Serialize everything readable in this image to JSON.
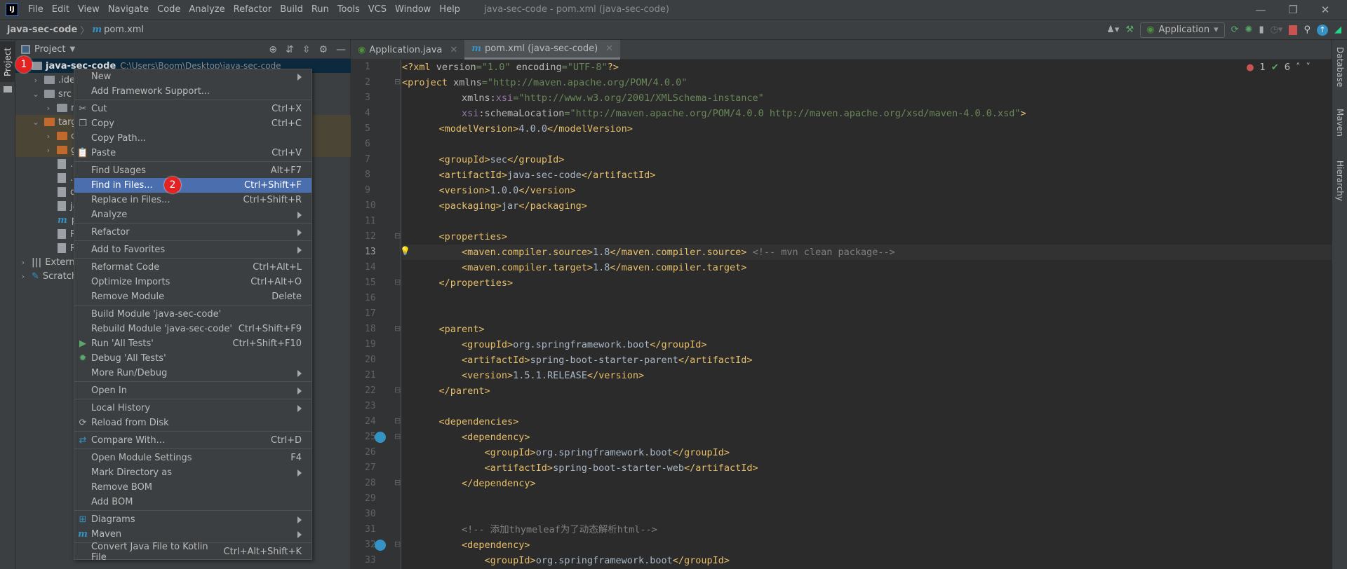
{
  "menubar": {
    "items": [
      "File",
      "Edit",
      "View",
      "Navigate",
      "Code",
      "Analyze",
      "Refactor",
      "Build",
      "Run",
      "Tools",
      "VCS",
      "Window",
      "Help"
    ],
    "window_title": "java-sec-code - pom.xml (java-sec-code)"
  },
  "navbar": {
    "project": "java-sec-code",
    "file": "pom.xml",
    "run_config": "Application"
  },
  "left_stripe": {
    "project_tab": "Project"
  },
  "right_stripe": {
    "tabs": [
      "Database",
      "Maven",
      "Hierarchy"
    ]
  },
  "project_panel": {
    "title": "Project",
    "rows": [
      {
        "text": "java-sec-code",
        "path": "C:\\Users\\Boom\\Desktop\\java-sec-code",
        "indent": 0,
        "arrow": "",
        "icon": "module-folder",
        "selected": true
      },
      {
        "text": ".ide",
        "indent": 1,
        "arrow": "›",
        "icon": "folder"
      },
      {
        "text": "src",
        "indent": 1,
        "arrow": "⌄",
        "icon": "folder"
      },
      {
        "text": "r",
        "indent": 2,
        "arrow": "›",
        "icon": "folder"
      },
      {
        "text": "targ",
        "indent": 1,
        "arrow": "⌄",
        "icon": "folder-excluded",
        "excluded": true
      },
      {
        "text": "c",
        "indent": 2,
        "arrow": "›",
        "icon": "folder-excluded",
        "excluded": true
      },
      {
        "text": "g",
        "indent": 2,
        "arrow": "›",
        "icon": "folder-excluded",
        "excluded": true
      },
      {
        "text": ".gita",
        "indent": 2,
        "arrow": "",
        "icon": "file"
      },
      {
        "text": ".giti",
        "indent": 2,
        "arrow": "",
        "icon": "file"
      },
      {
        "text": "doc",
        "indent": 2,
        "arrow": "",
        "icon": "file"
      },
      {
        "text": "java",
        "indent": 2,
        "arrow": "",
        "icon": "file"
      },
      {
        "text": "por",
        "indent": 2,
        "arrow": "",
        "icon": "maven"
      },
      {
        "text": "REA",
        "indent": 2,
        "arrow": "",
        "icon": "file"
      },
      {
        "text": "REA",
        "indent": 2,
        "arrow": "",
        "icon": "file"
      },
      {
        "text": "Externa",
        "indent": 0,
        "arrow": "›",
        "icon": "libraries"
      },
      {
        "text": "Scratch",
        "indent": 0,
        "arrow": "›",
        "icon": "scratch"
      }
    ]
  },
  "badges": [
    "1",
    "2"
  ],
  "tabs": [
    {
      "label": "Application.java",
      "active": false
    },
    {
      "label": "pom.xml (java-sec-code)",
      "active": true
    }
  ],
  "inspections": {
    "errors": "1",
    "warnings": "6"
  },
  "editor": {
    "current_line": 13,
    "lines": [
      [
        [
          "tag",
          "<?xml "
        ],
        [
          "at",
          "version"
        ],
        [
          "st",
          "=\"1.0\" "
        ],
        [
          "at",
          "encoding"
        ],
        [
          "st",
          "=\"UTF-8\""
        ],
        [
          "tag",
          "?>"
        ]
      ],
      [
        [
          "tag",
          "<project "
        ],
        [
          "at",
          "xmlns"
        ],
        [
          "st",
          "=\"http://maven.apache.org/POM/4.0.0\""
        ]
      ],
      [
        [
          "at",
          "        xmlns:"
        ],
        [
          "ns",
          "xsi"
        ],
        [
          "st",
          "=\"http://www.w3.org/2001/XMLSchema-instance\""
        ]
      ],
      [
        [
          "ns",
          "        xsi"
        ],
        [
          "at",
          ":schemaLocation"
        ],
        [
          "st",
          "=\"http://maven.apache.org/POM/4.0.0 http://maven.apache.org/xsd/maven-4.0.0.xsd\""
        ],
        [
          "tag",
          ">"
        ]
      ],
      [
        [
          "tag",
          "    <modelVersion>"
        ],
        [
          "tx",
          "4.0.0"
        ],
        [
          "tag",
          "</modelVersion>"
        ]
      ],
      [],
      [
        [
          "tag",
          "    <groupId>"
        ],
        [
          "tx",
          "sec"
        ],
        [
          "tag",
          "</groupId>"
        ]
      ],
      [
        [
          "tag",
          "    <artifactId>"
        ],
        [
          "tx",
          "java-sec-code"
        ],
        [
          "tag",
          "</artifactId>"
        ]
      ],
      [
        [
          "tag",
          "    <version>"
        ],
        [
          "tx",
          "1.0.0"
        ],
        [
          "tag",
          "</version>"
        ]
      ],
      [
        [
          "tag",
          "    <packaging>"
        ],
        [
          "tx",
          "jar"
        ],
        [
          "tag",
          "</packaging>"
        ]
      ],
      [],
      [
        [
          "tag",
          "    <properties>"
        ]
      ],
      [
        [
          "tag",
          "        <maven.compiler.source>"
        ],
        [
          "tx",
          "1.8"
        ],
        [
          "tag",
          "</maven.compiler.source> "
        ],
        [
          "cm",
          "<!-- mvn clean package-->"
        ]
      ],
      [
        [
          "tag",
          "        <maven.compiler.target>"
        ],
        [
          "tx",
          "1.8"
        ],
        [
          "tag",
          "</maven.compiler.target>"
        ]
      ],
      [
        [
          "tag",
          "    </properties>"
        ]
      ],
      [],
      [],
      [
        [
          "tag",
          "    <parent>"
        ]
      ],
      [
        [
          "tag",
          "        <groupId>"
        ],
        [
          "tx",
          "org.springframework.boot"
        ],
        [
          "tag",
          "</groupId>"
        ]
      ],
      [
        [
          "tag",
          "        <artifactId>"
        ],
        [
          "tx",
          "spring-boot-starter-parent"
        ],
        [
          "tag",
          "</artifactId>"
        ]
      ],
      [
        [
          "tag",
          "        <version>"
        ],
        [
          "tx",
          "1.5.1.RELEASE"
        ],
        [
          "tag",
          "</version>"
        ]
      ],
      [
        [
          "tag",
          "    </parent>"
        ]
      ],
      [],
      [
        [
          "tag",
          "    <dependencies>"
        ]
      ],
      [
        [
          "tag",
          "        <dependency>"
        ]
      ],
      [
        [
          "tag",
          "            <groupId>"
        ],
        [
          "tx",
          "org.springframework.boot"
        ],
        [
          "tag",
          "</groupId>"
        ]
      ],
      [
        [
          "tag",
          "            <artifactId>"
        ],
        [
          "tx",
          "spring-boot-starter-web"
        ],
        [
          "tag",
          "</artifactId>"
        ]
      ],
      [
        [
          "tag",
          "        </dependency>"
        ]
      ],
      [],
      [],
      [
        [
          "cm",
          "        <!-- 添加thymeleaf为了动态解析html-->"
        ]
      ],
      [
        [
          "tag",
          "        <dependency>"
        ]
      ],
      [
        [
          "tag",
          "            <groupId>"
        ],
        [
          "tx",
          "org.springframework.boot"
        ],
        [
          "tag",
          "</groupId>"
        ]
      ]
    ]
  },
  "context_menu": {
    "groups": [
      [
        {
          "label": "New",
          "submenu": true
        },
        {
          "label": "Add Framework Support..."
        }
      ],
      [
        {
          "label": "Cut",
          "shortcut": "Ctrl+X",
          "icon": "cut-icon"
        },
        {
          "label": "Copy",
          "shortcut": "Ctrl+C",
          "icon": "copy-icon"
        },
        {
          "label": "Copy Path..."
        },
        {
          "label": "Paste",
          "shortcut": "Ctrl+V",
          "icon": "paste-icon"
        }
      ],
      [
        {
          "label": "Find Usages",
          "shortcut": "Alt+F7"
        },
        {
          "label": "Find in Files...",
          "shortcut": "Ctrl+Shift+F",
          "highlighted": true
        },
        {
          "label": "Replace in Files...",
          "shortcut": "Ctrl+Shift+R"
        },
        {
          "label": "Analyze",
          "submenu": true
        }
      ],
      [
        {
          "label": "Refactor",
          "submenu": true
        }
      ],
      [
        {
          "label": "Add to Favorites",
          "submenu": true
        }
      ],
      [
        {
          "label": "Reformat Code",
          "shortcut": "Ctrl+Alt+L"
        },
        {
          "label": "Optimize Imports",
          "shortcut": "Ctrl+Alt+O"
        },
        {
          "label": "Remove Module",
          "shortcut": "Delete"
        }
      ],
      [
        {
          "label": "Build Module 'java-sec-code'"
        },
        {
          "label": "Rebuild Module 'java-sec-code'",
          "shortcut": "Ctrl+Shift+F9"
        },
        {
          "label": "Run 'All Tests'",
          "shortcut": "Ctrl+Shift+F10",
          "icon": "run-icon"
        },
        {
          "label": "Debug 'All Tests'",
          "icon": "debug-icon"
        },
        {
          "label": "More Run/Debug",
          "submenu": true
        }
      ],
      [
        {
          "label": "Open In",
          "submenu": true
        }
      ],
      [
        {
          "label": "Local History",
          "submenu": true
        },
        {
          "label": "Reload from Disk",
          "icon": "reload-icon"
        }
      ],
      [
        {
          "label": "Compare With...",
          "shortcut": "Ctrl+D",
          "icon": "compare-icon"
        }
      ],
      [
        {
          "label": "Open Module Settings",
          "shortcut": "F4"
        },
        {
          "label": "Mark Directory as",
          "submenu": true
        },
        {
          "label": "Remove BOM"
        },
        {
          "label": "Add BOM"
        }
      ],
      [
        {
          "label": "Diagrams",
          "submenu": true,
          "icon": "diagrams-icon"
        },
        {
          "label": "Maven",
          "submenu": true,
          "icon": "maven-icon"
        }
      ],
      [
        {
          "label": "Convert Java File to Kotlin File",
          "shortcut": "Ctrl+Alt+Shift+K"
        }
      ]
    ]
  },
  "colors": {
    "highlight": "#4b6eaf",
    "badge": "#e52222",
    "tag": "#e8bf6a",
    "string": "#6a8759"
  }
}
